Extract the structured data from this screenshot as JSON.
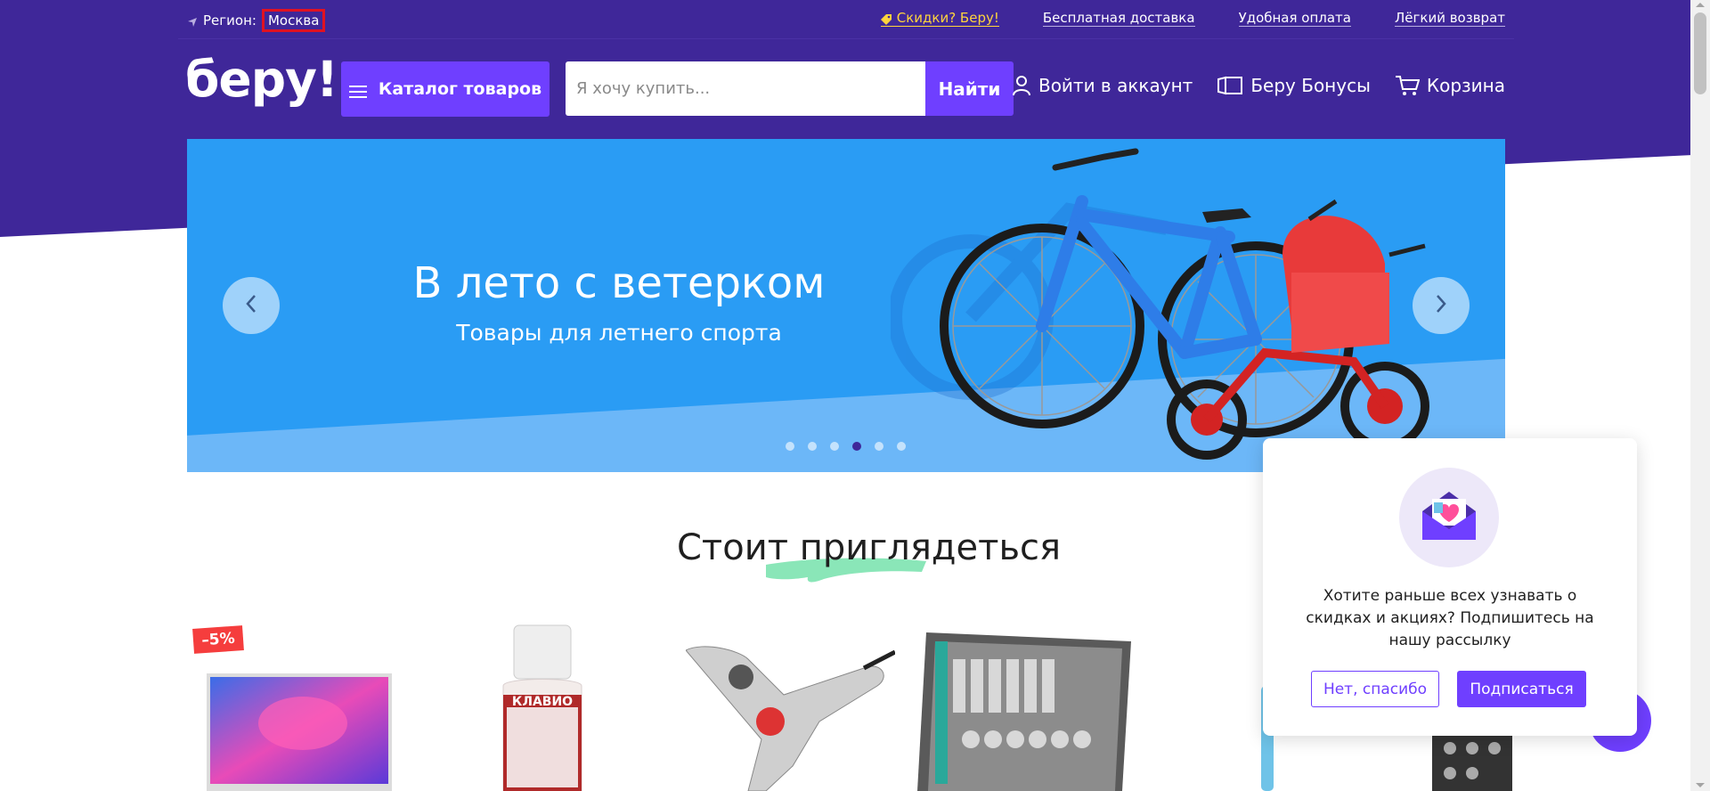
{
  "topbar": {
    "region_label": "Регион:",
    "region_city": "Москва",
    "links": [
      "Скидки? Беру!",
      "Бесплатная доставка",
      "Удобная оплата",
      "Лёгкий возврат"
    ]
  },
  "header": {
    "logo": "беру!",
    "catalog_label": "Каталог товаров",
    "search_placeholder": "Я хочу купить...",
    "search_button": "Найти",
    "login_label": "Войти в аккаунт",
    "bonus_label": "Беру Бонусы",
    "cart_label": "Корзина"
  },
  "banner": {
    "title": "В лето с ветерком",
    "subtitle": "Товары для летнего спорта",
    "dot_count": 6,
    "active_dot": 3
  },
  "section": {
    "title": "Стоит приглядеться"
  },
  "products": {
    "discount_badge": "–5%",
    "bottle_label": "КЛАВИО"
  },
  "popup": {
    "text": "Хотите раньше всех узнавать о скидках и акциях? Подпишитесь на нашу рассылку",
    "decline": "Нет, спасибо",
    "accept": "Подписаться"
  },
  "colors": {
    "header_bg": "#3f2799",
    "accent": "#6f3fff",
    "banner_bg": "#2a9cf4",
    "discount_link": "#ffd43d",
    "badge": "#f53d3d"
  }
}
